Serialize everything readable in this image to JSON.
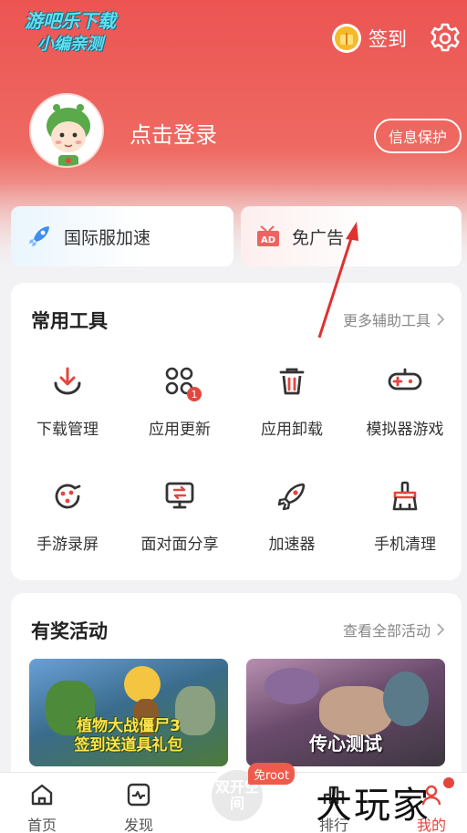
{
  "watermark": {
    "line1": "游吧乐下载",
    "line2": "小编亲测"
  },
  "header": {
    "signin_label": "签到",
    "login_text": "点击登录",
    "info_protect": "信息保护"
  },
  "features": [
    {
      "label": "国际服加速",
      "icon": "rocket-icon"
    },
    {
      "label": "免广告",
      "icon": "ad-icon"
    }
  ],
  "tools": {
    "title": "常用工具",
    "more": "更多辅助工具",
    "items": [
      {
        "label": "下载管理",
        "icon": "download-icon"
      },
      {
        "label": "应用更新",
        "icon": "app-update-icon",
        "badge": "1"
      },
      {
        "label": "应用卸载",
        "icon": "trash-icon"
      },
      {
        "label": "模拟器游戏",
        "icon": "gamepad-icon"
      },
      {
        "label": "手游录屏",
        "icon": "screen-record-icon"
      },
      {
        "label": "面对面分享",
        "icon": "face-share-icon"
      },
      {
        "label": "加速器",
        "icon": "rocket-icon"
      },
      {
        "label": "手机清理",
        "icon": "broom-icon"
      }
    ]
  },
  "events": {
    "title": "有奖活动",
    "more": "查看全部活动",
    "banners": [
      {
        "text_line1": "植物大战僵尸3",
        "text_line2": "签到送道具礼包"
      },
      {
        "text": "传心测试"
      }
    ]
  },
  "bottom_nav": {
    "items": [
      {
        "label": "首页",
        "icon": "home-icon"
      },
      {
        "label": "发现",
        "icon": "discover-icon"
      },
      {
        "label": "排行",
        "icon": "rank-icon"
      },
      {
        "label": "我的",
        "icon": "profile-icon"
      }
    ],
    "center_label": "双开空间",
    "center_tag": "免root"
  },
  "brand_mark": "大玩家",
  "colors": {
    "accent": "#e4463f",
    "header_red": "#ec5452"
  }
}
